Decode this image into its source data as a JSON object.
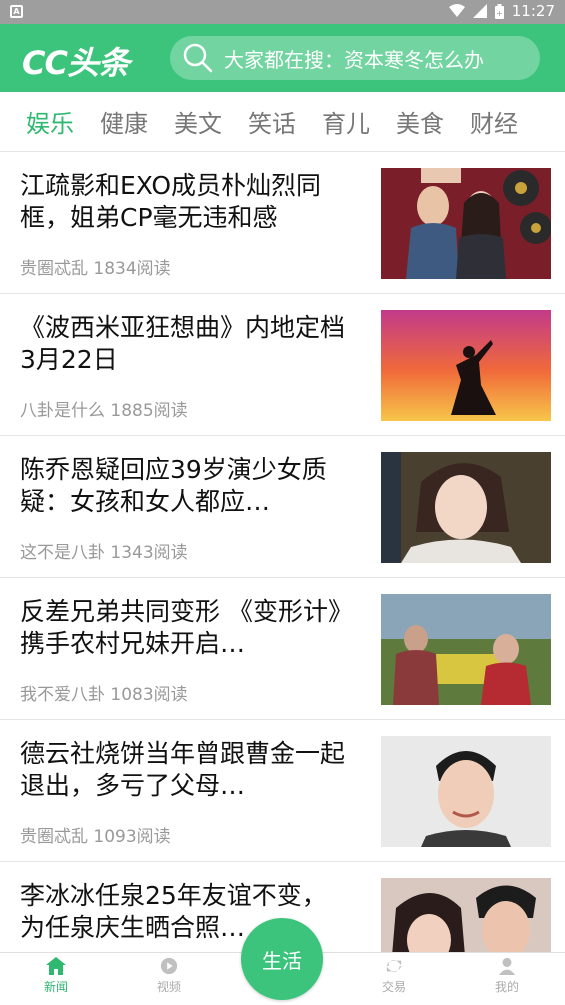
{
  "status_bar": {
    "time": "11:27",
    "app_icon_letter": "A"
  },
  "header": {
    "logo": "CC头条",
    "search_placeholder": "大家都在搜：资本寒冬怎么办"
  },
  "tabs": [
    "娱乐",
    "健康",
    "美文",
    "笑话",
    "育儿",
    "美食",
    "财经"
  ],
  "active_tab": "娱乐",
  "feed": [
    {
      "title": "江疏影和EXO成员朴灿烈同框，姐弟CP毫无违和感",
      "source": "贵圈忒乱",
      "reads": "1834阅读"
    },
    {
      "title": "《波西米亚狂想曲》内地定档3月22日",
      "source": "八卦是什么",
      "reads": "1885阅读"
    },
    {
      "title": "陈乔恩疑回应39岁演少女质疑：女孩和女人都应…",
      "source": "这不是八卦",
      "reads": "1343阅读"
    },
    {
      "title": "反差兄弟共同变形 《变形计》携手农村兄妹开启…",
      "source": "我不爱八卦",
      "reads": "1083阅读"
    },
    {
      "title": "德云社烧饼当年曾跟曹金一起退出，多亏了父母…",
      "source": "贵圈忒乱",
      "reads": "1093阅读"
    },
    {
      "title": "李冰冰任泉25年友谊不变，为任泉庆生晒合照…",
      "source": "",
      "reads": ""
    }
  ],
  "bottom_nav": {
    "news": "新闻",
    "video": "视频",
    "life": "生活",
    "trade": "交易",
    "mine": "我的"
  },
  "colors": {
    "brand": "#3cc47c",
    "active_tab": "#2fb870"
  }
}
